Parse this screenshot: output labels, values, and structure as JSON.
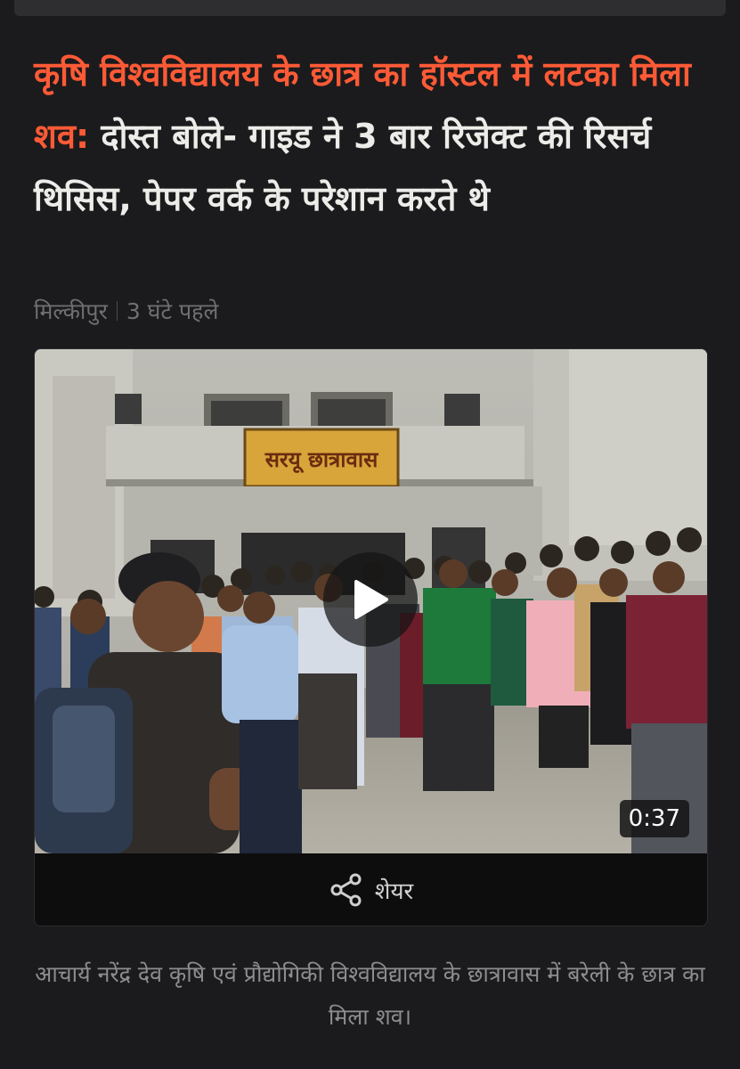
{
  "article": {
    "headline_highlight": "कृषि विश्वविद्यालय के छात्र का हॉस्टल में लटका मिला शव:",
    "headline_rest": " दोस्त बोले- गाइड ने 3 बार रिजेक्ट की रिसर्च थिसिस, पेपर वर्क के परेशान करते थे",
    "location": "मिल्कीपुर",
    "time_ago": "3 घंटे पहले",
    "image_signboard": "सरयू छात्रावास",
    "caption": "आचार्य नरेंद्र देव कृषि एवं प्रौद्योगिकी विश्वविद्यालय के छात्रावास में बरेली के छात्र का मिला शव।"
  },
  "video": {
    "duration": "0:37",
    "play_icon": "play-icon",
    "share_label": "शेयर",
    "share_icon": "share-icon"
  },
  "colors": {
    "background": "#1b1b1d",
    "headline_highlight": "#ff5a36",
    "headline_text": "#ecece9",
    "meta_text": "#6f6f72",
    "caption_text": "#8d8d90"
  }
}
